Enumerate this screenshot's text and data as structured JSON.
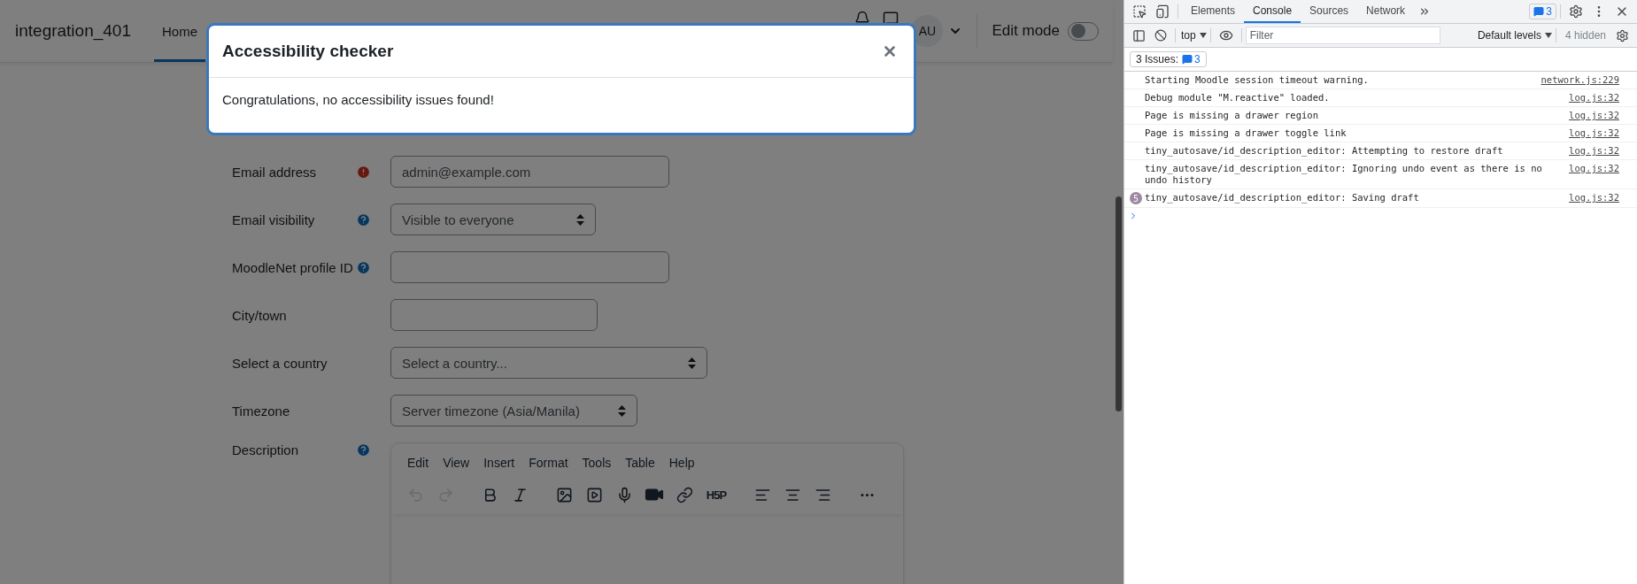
{
  "navbar": {
    "brand": "integration_401",
    "items": [
      {
        "label": "Home",
        "selected": true
      }
    ],
    "avatar": "AU",
    "edit_mode": {
      "label": "Edit mode",
      "on": false
    }
  },
  "form": {
    "fields": [
      {
        "label": "Email address",
        "kind": "text",
        "value": "admin@example.com",
        "required": true,
        "help": false
      },
      {
        "label": "Email visibility",
        "kind": "select",
        "value": "Visible to everyone",
        "required": false,
        "help": true
      },
      {
        "label": "MoodleNet profile ID",
        "kind": "text",
        "required": false,
        "help": true
      },
      {
        "label": "City/town",
        "kind": "text",
        "required": false,
        "help": false
      },
      {
        "label": "Select a country",
        "kind": "select",
        "value": "Select a country...",
        "required": false,
        "help": false
      },
      {
        "label": "Timezone",
        "kind": "select",
        "value": "Server timezone (Asia/Manila)",
        "required": false,
        "help": false
      }
    ],
    "description": {
      "label": "Description",
      "required": false,
      "help": true,
      "menu": [
        "Edit",
        "View",
        "Insert",
        "Format",
        "Tools",
        "Table",
        "Help"
      ],
      "toolbar": [
        {
          "kind": "undo",
          "disabled": true
        },
        {
          "kind": "redo",
          "disabled": true
        },
        {
          "kind": "gap"
        },
        {
          "kind": "bold",
          "disabled": false
        },
        {
          "kind": "italic",
          "disabled": false
        },
        {
          "kind": "gap"
        },
        {
          "kind": "image",
          "disabled": false
        },
        {
          "kind": "media",
          "disabled": false
        },
        {
          "kind": "audio",
          "disabled": false
        },
        {
          "kind": "video",
          "disabled": false
        },
        {
          "kind": "link",
          "disabled": false
        },
        {
          "kind": "h5p",
          "label": "H5P",
          "disabled": false
        },
        {
          "kind": "gap"
        },
        {
          "kind": "align-left",
          "disabled": false
        },
        {
          "kind": "align-center",
          "disabled": false
        },
        {
          "kind": "align-right",
          "disabled": false
        },
        {
          "kind": "gap"
        },
        {
          "kind": "more",
          "disabled": false
        }
      ]
    }
  },
  "modal": {
    "title": "Accessibility checker",
    "message": "Congratulations, no accessibility issues found!"
  },
  "devtools": {
    "tabs": [
      {
        "label": "Elements",
        "selected": false
      },
      {
        "label": "Console",
        "selected": true
      },
      {
        "label": "Sources",
        "selected": false
      },
      {
        "label": "Network",
        "selected": false
      }
    ],
    "issues_badge": "3",
    "context": "top",
    "filter_placeholder": "Filter",
    "levels": "Default levels",
    "hidden": "4 hidden",
    "issues_button": {
      "label": "3 Issues:",
      "count": "3"
    },
    "messages": [
      {
        "text": "Starting Moodle session timeout warning.",
        "source": "network.js:229"
      },
      {
        "text": "Debug module \"M.reactive\" loaded.",
        "source": "log.js:32"
      },
      {
        "text": "Page is missing a drawer region",
        "source": "log.js:32"
      },
      {
        "text": "Page is missing a drawer toggle link",
        "source": "log.js:32"
      },
      {
        "text": "tiny_autosave/id_description_editor: Attempting to restore draft",
        "source": "log.js:32"
      },
      {
        "text": "tiny_autosave/id_description_editor: Ignoring undo event as there is no undo history",
        "source": "log.js:32"
      },
      {
        "text": "tiny_autosave/id_description_editor: Saving draft",
        "source": "log.js:32",
        "count": "5"
      }
    ]
  }
}
